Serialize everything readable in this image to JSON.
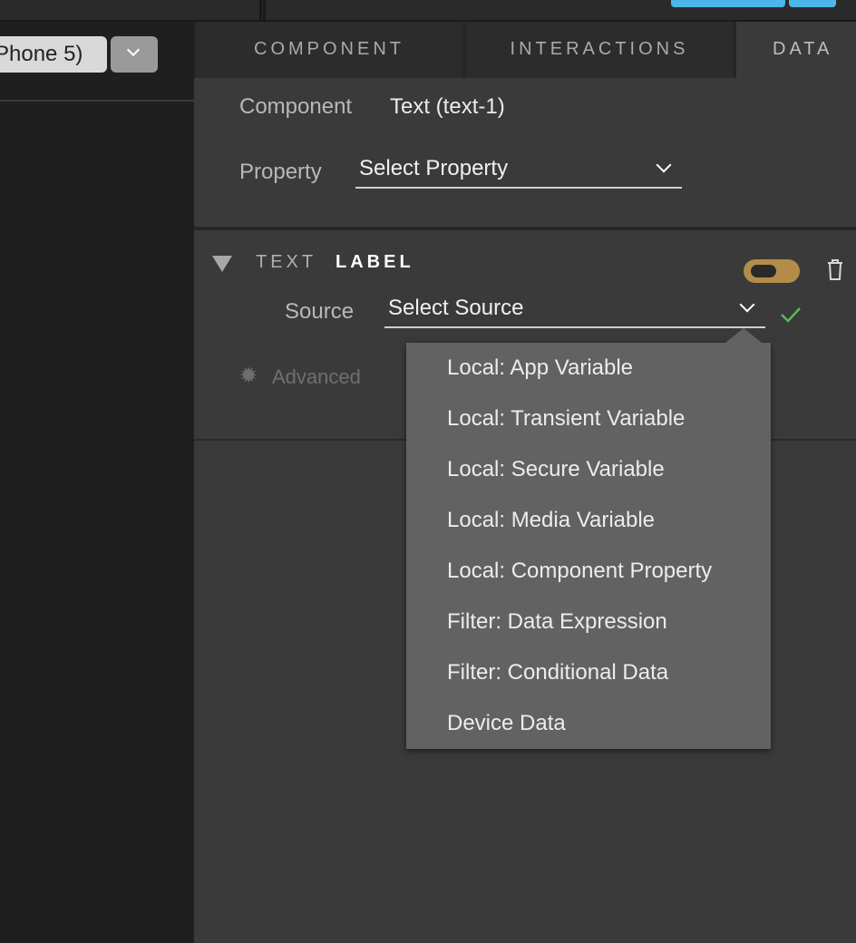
{
  "device": {
    "label": "Phone 5)"
  },
  "tabs": [
    {
      "label": "COMPONENT"
    },
    {
      "label": "INTERACTIONS"
    },
    {
      "label": "DATA"
    }
  ],
  "component_row": {
    "label": "Component",
    "value": "Text (text-1)"
  },
  "property_row": {
    "label": "Property",
    "value": "Select Property"
  },
  "section": {
    "title_prefix": "TEXT",
    "title_main": "LABEL"
  },
  "source_row": {
    "label": "Source",
    "value": "Select Source"
  },
  "advanced": {
    "label": "Advanced"
  },
  "source_options": [
    "Local: App Variable",
    "Local: Transient Variable",
    "Local: Secure Variable",
    "Local: Media Variable",
    "Local: Component Property",
    "Filter: Data Expression",
    "Filter: Conditional Data",
    "Device Data"
  ],
  "colors": {
    "accent_blue": "#4db6e8",
    "toggle_gold": "#b38c4a",
    "check_green": "#5cb85c"
  }
}
